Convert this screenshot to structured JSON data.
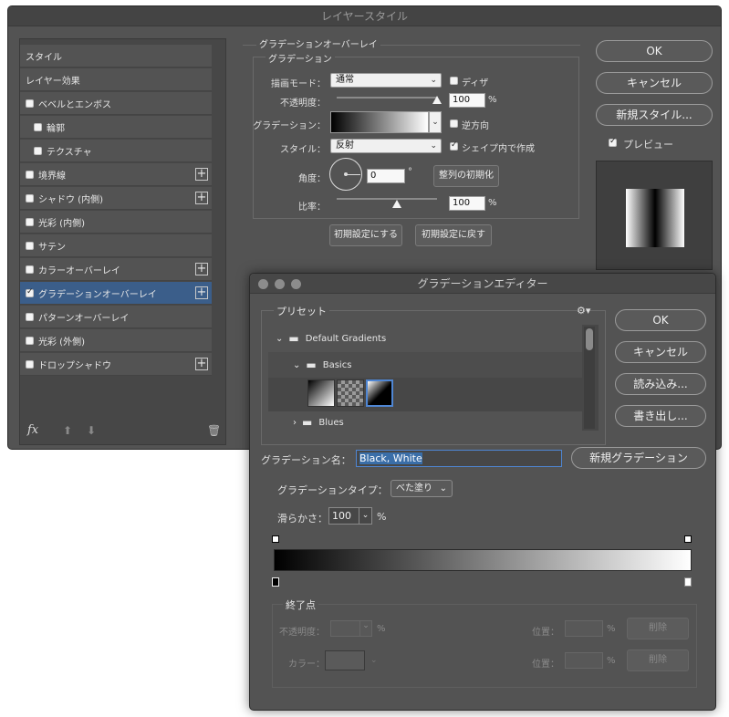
{
  "layer_style": {
    "title": "レイヤースタイル",
    "left_items": [
      {
        "label": "スタイル",
        "checkbox": false,
        "checked": false,
        "plus": false,
        "indent": false,
        "selected": false
      },
      {
        "label": "レイヤー効果",
        "checkbox": false,
        "checked": false,
        "plus": false,
        "indent": false,
        "selected": false
      },
      {
        "label": "ベベルとエンボス",
        "checkbox": true,
        "checked": false,
        "plus": false,
        "indent": false,
        "selected": false
      },
      {
        "label": "輪郭",
        "checkbox": true,
        "checked": false,
        "plus": false,
        "indent": true,
        "selected": false
      },
      {
        "label": "テクスチャ",
        "checkbox": true,
        "checked": false,
        "plus": false,
        "indent": true,
        "selected": false
      },
      {
        "label": "境界線",
        "checkbox": true,
        "checked": false,
        "plus": true,
        "indent": false,
        "selected": false
      },
      {
        "label": "シャドウ (内側)",
        "checkbox": true,
        "checked": false,
        "plus": true,
        "indent": false,
        "selected": false
      },
      {
        "label": "光彩 (内側)",
        "checkbox": true,
        "checked": false,
        "plus": false,
        "indent": false,
        "selected": false
      },
      {
        "label": "サテン",
        "checkbox": true,
        "checked": false,
        "plus": false,
        "indent": false,
        "selected": false
      },
      {
        "label": "カラーオーバーレイ",
        "checkbox": true,
        "checked": false,
        "plus": true,
        "indent": false,
        "selected": false
      },
      {
        "label": "グラデーションオーバーレイ",
        "checkbox": true,
        "checked": true,
        "plus": true,
        "indent": false,
        "selected": true
      },
      {
        "label": "パターンオーバーレイ",
        "checkbox": true,
        "checked": false,
        "plus": false,
        "indent": false,
        "selected": false
      },
      {
        "label": "光彩 (外側)",
        "checkbox": true,
        "checked": false,
        "plus": false,
        "indent": false,
        "selected": false
      },
      {
        "label": "ドロップシャドウ",
        "checkbox": true,
        "checked": false,
        "plus": true,
        "indent": false,
        "selected": false
      }
    ],
    "footer": {
      "fx": "fx"
    },
    "section_title": "グラデーションオーバーレイ",
    "group_title": "グラデーション",
    "blend_mode_label": "描画モード：",
    "blend_mode_value": "通常",
    "dither_label": "ディザ",
    "opacity_label": "不透明度：",
    "opacity_value": "100",
    "opacity_slider_percent": 100,
    "percent": "%",
    "gradient_label": "グラデーション：",
    "reverse_label": "逆方向",
    "style_label": "スタイル：",
    "style_value": "反射",
    "align_label": "シェイプ内で作成",
    "angle_label": "角度：",
    "angle_value": "0",
    "degree": "°",
    "reset_align_button": "整列の初期化",
    "scale_label": "比率：",
    "scale_value": "100",
    "scale_slider_percent": 60,
    "make_default_button": "初期設定にする",
    "reset_default_button": "初期設定に戻す",
    "ok_button": "OK",
    "cancel_button": "キャンセル",
    "new_style_button": "新規スタイル...",
    "preview_label": "プレビュー"
  },
  "gradient_editor": {
    "title": "グラデーションエディター",
    "presets_label": "プリセット",
    "folder_default": "Default Gradients",
    "folder_basics": "Basics",
    "folder_blues": "Blues",
    "ok_button": "OK",
    "cancel_button": "キャンセル",
    "load_button": "読み込み...",
    "save_button": "書き出し...",
    "name_label": "グラデーション名：",
    "name_value": "Black, White",
    "new_gradient_button": "新規グラデーション",
    "type_label": "グラデーションタイプ：",
    "type_value": "べた塗り",
    "smoothness_label": "滑らかさ：",
    "smoothness_value": "100",
    "percent": "%",
    "stops_group_title": "終了点",
    "stop_opacity_label": "不透明度：",
    "stop_location_label": "位置：",
    "stop_delete_button": "削除",
    "stop_color_label": "カラー："
  }
}
